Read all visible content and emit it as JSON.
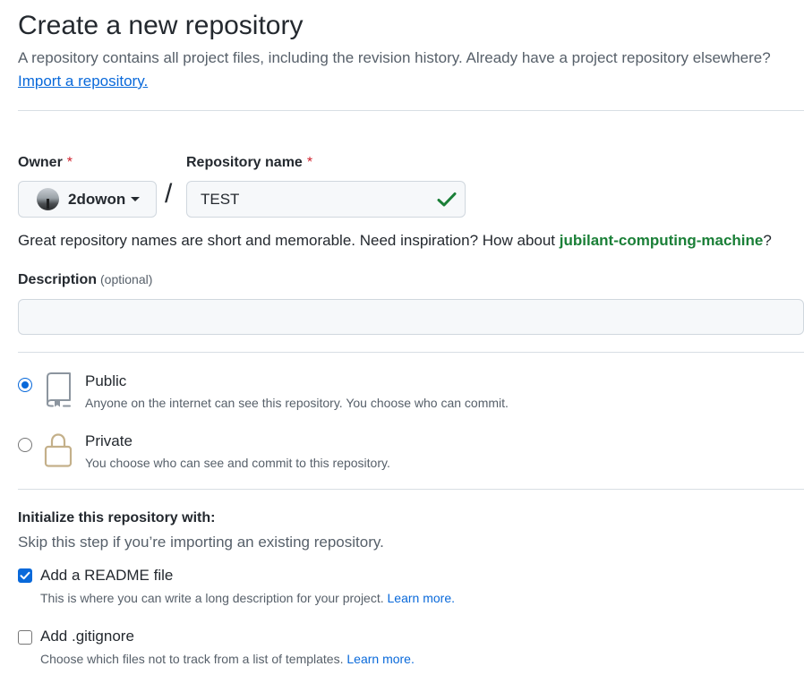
{
  "header": {
    "title": "Create a new repository",
    "subtitle": "A repository contains all project files, including the revision history. Already have a project repository elsewhere?",
    "import_link": "Import a repository."
  },
  "owner": {
    "label": "Owner",
    "required_mark": "*",
    "selected": "2dowon"
  },
  "separator": "/",
  "repo_name": {
    "label": "Repository name",
    "required_mark": "*",
    "value": "TEST",
    "valid": true
  },
  "hint": {
    "prefix": "Great repository names are short and memorable. Need inspiration? How about ",
    "suggestion": "jubilant-computing-machine",
    "suffix": "?"
  },
  "description": {
    "label": "Description",
    "optional": "(optional)",
    "value": ""
  },
  "visibility": {
    "selected": "public",
    "options": [
      {
        "id": "public",
        "title": "Public",
        "desc": "Anyone on the internet can see this repository. You choose who can commit.",
        "icon": "repo-icon"
      },
      {
        "id": "private",
        "title": "Private",
        "desc": "You choose who can see and commit to this repository.",
        "icon": "lock-icon"
      }
    ]
  },
  "init": {
    "title": "Initialize this repository with:",
    "subtitle": "Skip this step if you’re importing an existing repository.",
    "readme": {
      "checked": true,
      "title": "Add a README file",
      "desc": "This is where you can write a long description for your project.",
      "learn_more": "Learn more."
    },
    "gitignore": {
      "checked": false,
      "title": "Add .gitignore",
      "desc": "Choose which files not to track from a list of templates.",
      "learn_more": "Learn more."
    }
  },
  "colors": {
    "accent": "#0969da",
    "success": "#1a7f37",
    "danger": "#cf222e",
    "muted": "#57606a",
    "lock_icon": "#c4b08a"
  }
}
